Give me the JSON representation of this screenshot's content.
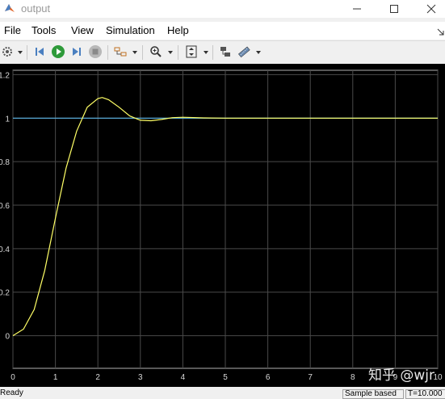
{
  "window": {
    "title": "output"
  },
  "menu": {
    "items": [
      "File",
      "Tools",
      "View",
      "Simulation",
      "Help"
    ]
  },
  "toolbar": {
    "icons": [
      "settings-icon",
      "step-back-icon",
      "run-icon",
      "step-forward-icon",
      "stop-icon",
      "signal-selector-icon",
      "zoom-in-icon",
      "autoscale-icon",
      "highlight-block-icon",
      "measurement-icon"
    ]
  },
  "chart_data": {
    "type": "line",
    "xlim": [
      0,
      10
    ],
    "ylim": [
      -0.15,
      1.22
    ],
    "x_ticks": [
      0,
      1,
      2,
      3,
      4,
      5,
      6,
      7,
      8,
      9,
      10
    ],
    "x_tick_labels": [
      "0",
      "1",
      "2",
      "3",
      "4",
      "5",
      "6",
      "7",
      "8",
      "9",
      "10"
    ],
    "y_ticks": [
      0,
      0.2,
      0.4,
      0.6,
      0.8,
      1,
      1.2
    ],
    "y_tick_labels": [
      "0",
      "0.2",
      "0.4",
      "0.6",
      "0.8",
      "1",
      "1.2"
    ],
    "grid": true,
    "background": "#000000",
    "series": [
      {
        "color": "#5ab4e6",
        "x": [
          0,
          10
        ],
        "y": [
          1,
          1
        ]
      },
      {
        "color": "#ffff66",
        "x": [
          0,
          0.25,
          0.5,
          0.75,
          1.0,
          1.25,
          1.5,
          1.75,
          2.0,
          2.1,
          2.25,
          2.5,
          2.75,
          3.0,
          3.25,
          3.5,
          3.75,
          4.0,
          4.5,
          5.0,
          6.0,
          8.0,
          10.0
        ],
        "y": [
          0,
          0.03,
          0.12,
          0.3,
          0.54,
          0.77,
          0.94,
          1.05,
          1.09,
          1.095,
          1.085,
          1.05,
          1.01,
          0.99,
          0.988,
          0.994,
          1.002,
          1.004,
          1.001,
          1.0,
          1.0,
          1.0,
          1.0
        ]
      }
    ]
  },
  "watermark": {
    "text": "知乎 @wjr"
  },
  "status": {
    "ready": "Ready",
    "sample": "Sample based",
    "time": "T=10.000"
  }
}
